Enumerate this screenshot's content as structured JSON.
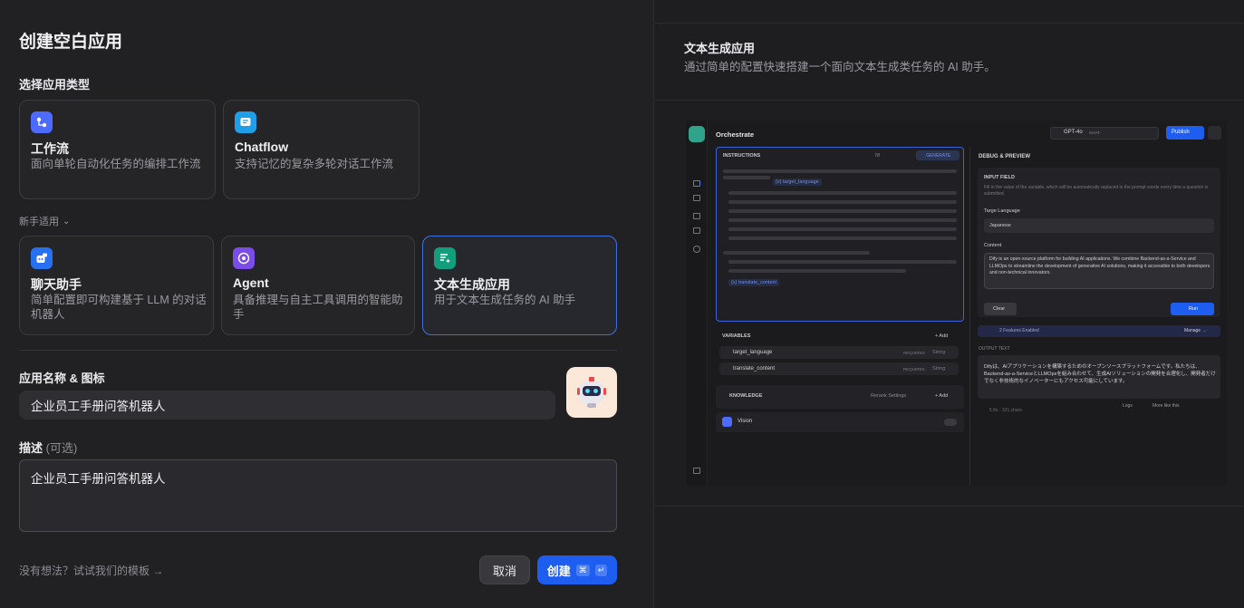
{
  "dialog": {
    "title": "创建空白应用",
    "select_type": "选择应用类型",
    "beginner": "新手适用"
  },
  "types_top": [
    {
      "name": "工作流",
      "desc": "面向单轮自动化任务的编排工作流",
      "icon": "workflow-icon",
      "color": "#4d6bfe"
    },
    {
      "name": "Chatflow",
      "desc": "支持记忆的复杂多轮对话工作流",
      "icon": "chatflow-icon",
      "color": "#1f9fe8"
    }
  ],
  "types_bottom": [
    {
      "name": "聊天助手",
      "desc": "简单配置即可构建基于 LLM 的对话机器人",
      "icon": "chatbot-icon",
      "color": "#2770f0"
    },
    {
      "name": "Agent",
      "desc": "具备推理与自主工具调用的智能助手",
      "icon": "agent-icon",
      "color": "#7a4ce8"
    },
    {
      "name": "文本生成应用",
      "desc": "用于文本生成任务的 AI 助手",
      "icon": "text-generator-icon",
      "color": "#129e7d"
    }
  ],
  "form": {
    "name_label": "应用名称 & 图标",
    "name_value": "企业员工手册问答机器人",
    "desc_label": "描述",
    "desc_optional": "(可选)",
    "desc_value": "企业员工手册问答机器人"
  },
  "footer": {
    "template_link": "没有想法？试试我们的模板 →",
    "cancel": "取消",
    "create": "创建",
    "kbd1": "⌘",
    "kbd2": "↵"
  },
  "preview": {
    "title": "文本生成应用",
    "subtitle": "通过简单的配置快速搭建一个面向文本生成类任务的 AI 助手。",
    "orchestrate": "Orchestrate",
    "model": "GPT-4o",
    "model_badge": "CHAT",
    "publish": "Publish",
    "instructions": "INSTRUCTIONS",
    "count": "78",
    "generate": "GENERATE",
    "var1": "{x} target_language",
    "var2": "{x} translate_content",
    "variables": "VARIABLES",
    "add": "+ Add",
    "vars": [
      {
        "name": "target_language",
        "req": "REQUIRED",
        "type": "String"
      },
      {
        "name": "translate_content",
        "req": "REQUIRED",
        "type": "String"
      }
    ],
    "knowledge": "KNOWLEDGE",
    "rerank": "Rerank Settings",
    "vision": "Vision",
    "debug": "DEBUG & PREVIEW",
    "input_field": "INPUT FIELD",
    "input_hint": "Fill in the value of the variable, which will be automatically replaced in the prompt words every time a question is submitted.",
    "target_label": "Targe Language",
    "target_value": "Japanese",
    "content_label": "Content",
    "content_value": "Dify is an open-source platform for building AI applications. We combine Backend-as-a-Service and LLMOps to streamline the development of generative AI solutions, making it accessible to both developers and non-technical innovators.",
    "clear": "Clear",
    "run": "Run",
    "features": "2 Features Enabled",
    "manage": "Manage →",
    "output_text": "OUTPUT TEXT",
    "output": "Difyは、AIアプリケーションを構築するためのオープンソースプラットフォームです。私たちは、Backend-as-a-ServiceとLLMOpsを組み合わせて、生成AIソリューションの開発を合理化し、開発者だけでなく非技術的なイノベーターにもアクセス可能にしています。",
    "stats": "5.8s · 321 chars",
    "logs": "Logs",
    "more_like": "More like this"
  }
}
